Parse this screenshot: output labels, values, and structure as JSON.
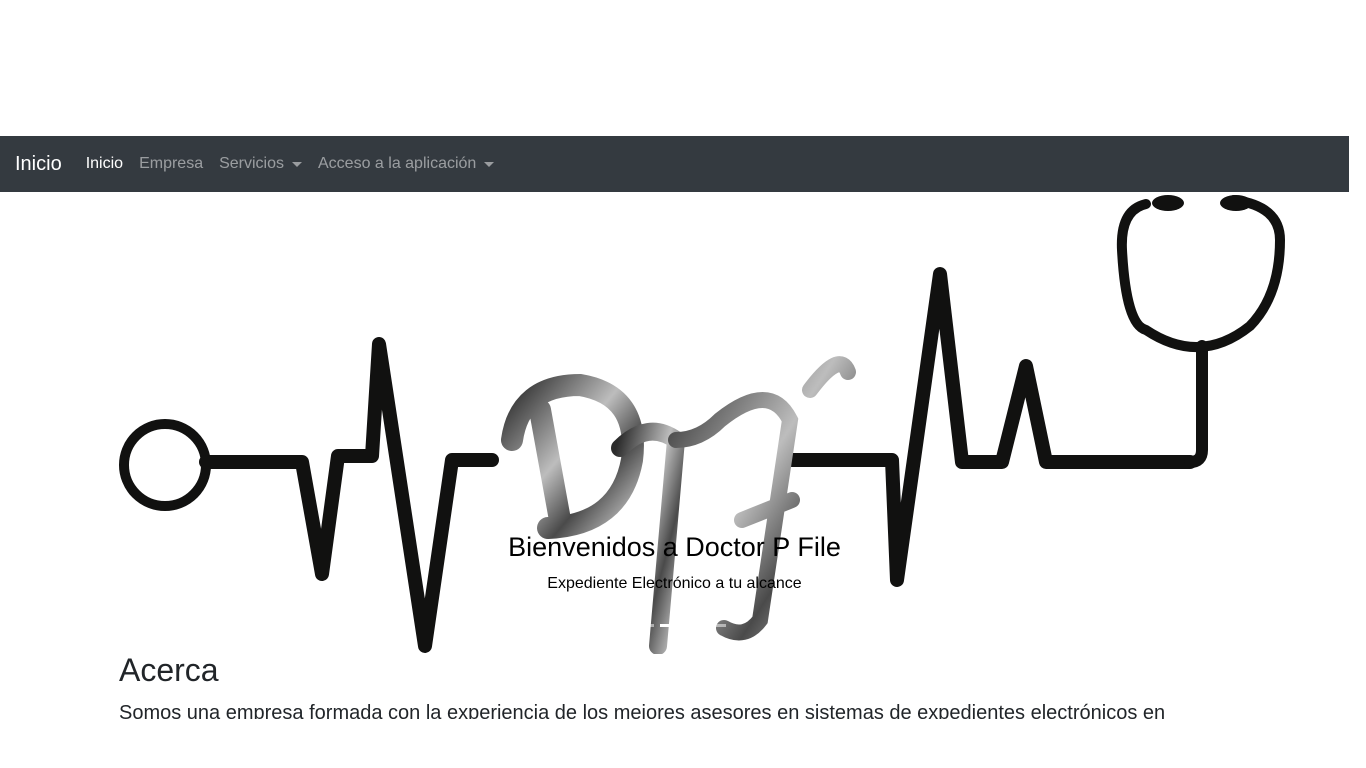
{
  "navbar": {
    "brand": "Inicio",
    "items": [
      {
        "label": "Inicio",
        "active": true,
        "dropdown": false
      },
      {
        "label": "Empresa",
        "active": false,
        "dropdown": false
      },
      {
        "label": "Servicios",
        "active": false,
        "dropdown": true
      },
      {
        "label": "Acceso a la aplicación",
        "active": false,
        "dropdown": true
      }
    ],
    "background": "#343a40"
  },
  "hero": {
    "logo_text": "DPF",
    "title": "Bienvenidos a Doctor P File",
    "subtitle": "Expediente Electrónico a tu alcance"
  },
  "about": {
    "heading": "Acerca",
    "text": "Somos una empresa formada con la experiencia de los mejores asesores en sistemas de expedientes electrónicos en"
  }
}
